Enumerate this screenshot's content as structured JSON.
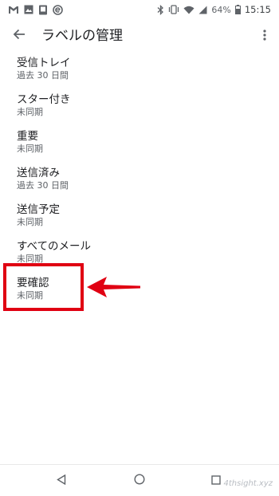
{
  "status_bar": {
    "left_icons": [
      "gmail-icon",
      "image-icon",
      "phone-icon",
      "e-circle-icon"
    ],
    "right_icons": [
      "bluetooth-icon",
      "vibrate-icon",
      "wifi-icon",
      "signal-icon",
      "battery-icon"
    ],
    "battery_percent": "64%",
    "time": "15:15"
  },
  "app_bar": {
    "title": "ラベルの管理",
    "back_icon": "arrow-back-icon",
    "overflow_icon": "more-vert-icon"
  },
  "labels": [
    {
      "name": "受信トレイ",
      "sync": "過去 30 日間"
    },
    {
      "name": "スター付き",
      "sync": "未同期"
    },
    {
      "name": "重要",
      "sync": "未同期"
    },
    {
      "name": "送信済み",
      "sync": "過去 30 日間"
    },
    {
      "name": "送信予定",
      "sync": "未同期"
    },
    {
      "name": "すべてのメール",
      "sync": "未同期"
    },
    {
      "name": "要確認",
      "sync": "未同期"
    }
  ],
  "annotation": {
    "color": "#e00012"
  },
  "nav_bar": {
    "buttons": [
      "back-triangle-icon",
      "home-circle-icon",
      "recents-square-icon"
    ]
  },
  "watermark": "4thsight.xyz"
}
